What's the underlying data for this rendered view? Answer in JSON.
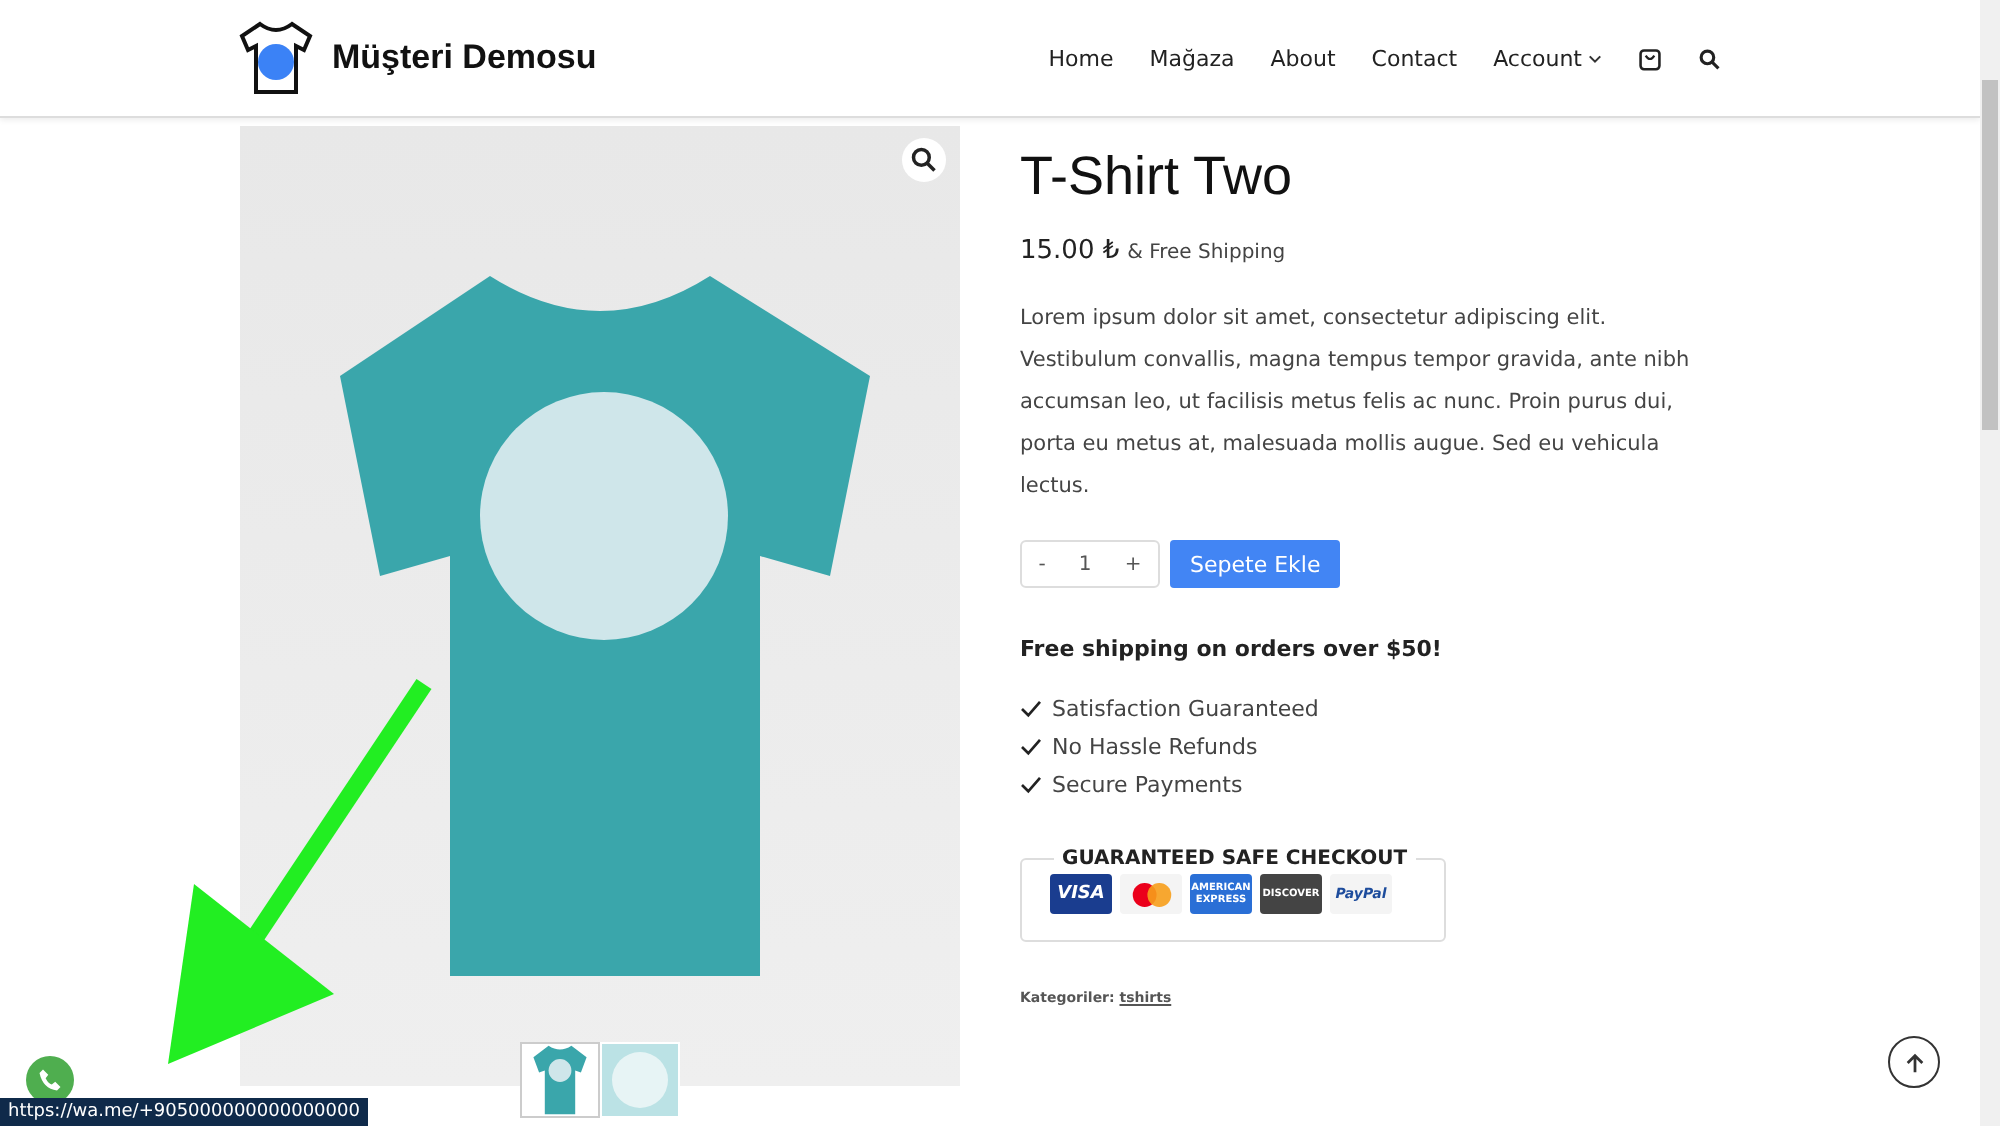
{
  "header": {
    "site_title": "Müşteri Demosu",
    "nav": [
      {
        "label": "Home",
        "kind": "link"
      },
      {
        "label": "Mağaza",
        "kind": "link"
      },
      {
        "label": "About",
        "kind": "link"
      },
      {
        "label": "Contact",
        "kind": "link"
      },
      {
        "label": "Account",
        "kind": "dropdown"
      },
      {
        "kind": "cart"
      },
      {
        "kind": "search"
      }
    ]
  },
  "product": {
    "title": "T-Shirt Two",
    "price": "15.00 ₺",
    "shipping_note": "& Free Shipping",
    "description": "Lorem ipsum dolor sit amet, consectetur adipiscing elit. Vestibulum convallis, magna tempus tempor gravida, ante nibh accumsan leo, ut facilisis metus felis ac nunc. Proin purus dui, porta eu metus at, malesuada mollis augue. Sed eu vehicula lectus.",
    "quantity": {
      "minus": "-",
      "value": "1",
      "plus": "+"
    },
    "add_to_cart": "Sepete Ekle",
    "free_shipping": "Free shipping on orders over $50!",
    "features": [
      "Satisfaction Guaranteed",
      "No Hassle Refunds",
      "Secure Payments"
    ],
    "checkout": {
      "title": "GUARANTEED SAFE CHECKOUT",
      "cards": [
        {
          "kind": "visa",
          "label": "VISA"
        },
        {
          "kind": "mastercard"
        },
        {
          "kind": "amex",
          "label": "AMERICAN EXPRESS"
        },
        {
          "kind": "discover",
          "label": "DISCOVER"
        },
        {
          "kind": "paypal",
          "label": "PayPal"
        }
      ]
    },
    "categories_label": "Kategoriler:",
    "category": "tshirts",
    "thumbnails": [
      {
        "kind": "shirt",
        "selected": true
      },
      {
        "kind": "detail",
        "selected": false
      }
    ]
  },
  "status_url": "https://wa.me/+905000000000000000"
}
